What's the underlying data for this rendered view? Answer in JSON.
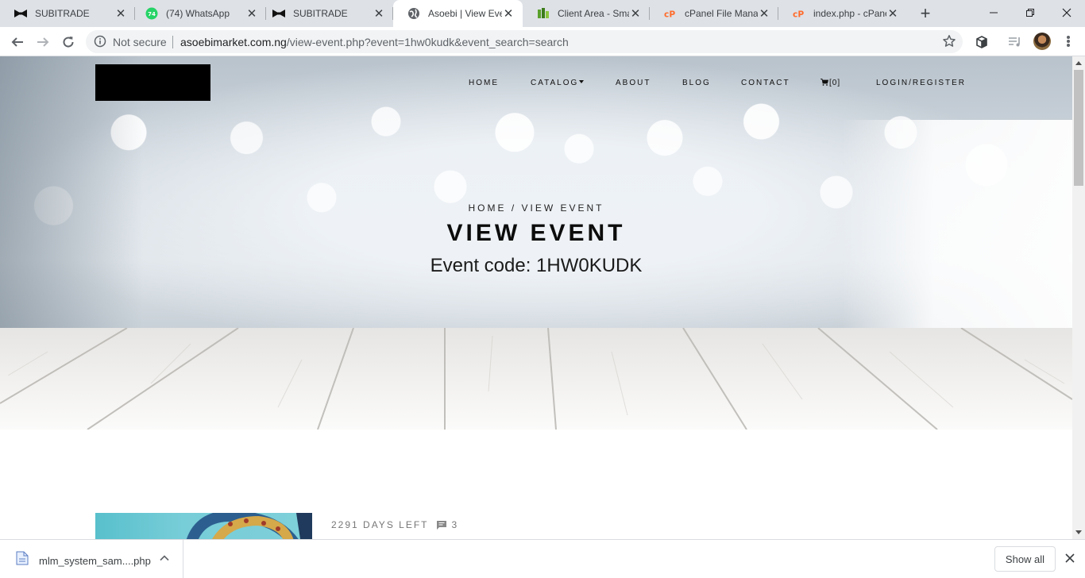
{
  "browser": {
    "tabs": [
      {
        "title": "SUBITRADE",
        "icon": "bowtie-icon",
        "active": false
      },
      {
        "title": "(74) WhatsApp",
        "icon": "whatsapp-icon",
        "badge": "74",
        "active": false
      },
      {
        "title": "SUBITRADE",
        "icon": "bowtie-icon",
        "active": false
      },
      {
        "title": "Asoebi | View Even",
        "icon": "globe-icon",
        "active": true
      },
      {
        "title": "Client Area - Smar",
        "icon": "client-area-icon",
        "active": false
      },
      {
        "title": "cPanel File Manag",
        "icon": "cpanel-icon",
        "active": false
      },
      {
        "title": "index.php - cPanel",
        "icon": "cpanel-icon",
        "active": false
      }
    ],
    "security_label": "Not secure",
    "url_host": "asoebimarket.com.ng",
    "url_path": "/view-event.php?event=1hw0kudk&event_search=search"
  },
  "site": {
    "nav": [
      {
        "label": "HOME"
      },
      {
        "label": "CATALOG",
        "has_dropdown": true
      },
      {
        "label": "ABOUT"
      },
      {
        "label": "BLOG"
      },
      {
        "label": "CONTACT"
      },
      {
        "label": "[0]",
        "icon": "cart-icon"
      },
      {
        "label": "LOGIN/REGISTER"
      }
    ],
    "breadcrumb": "HOME / VIEW EVENT",
    "page_title": "VIEW EVENT",
    "event_code": "Event code: 1HW0KUDK",
    "event": {
      "days_left": "2291 DAYS LEFT",
      "comments": "3"
    }
  },
  "downloads": {
    "file_name": "mlm_system_sam....php",
    "show_all": "Show all"
  },
  "colors": {
    "tabstrip": "#dee1e6",
    "whatsapp": "#25d366",
    "cpanel": "#ff6c2c",
    "text_dark": "#111111"
  }
}
